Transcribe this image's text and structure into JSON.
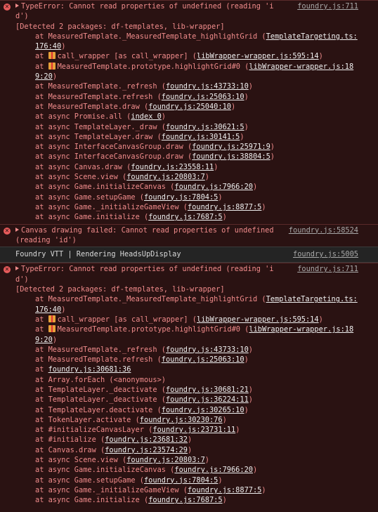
{
  "entries": [
    {
      "kind": "error",
      "source": "foundry.js:711",
      "message": "TypeError: Cannot read properties of undefined (reading 'id')",
      "detected": "[Detected 2 packages: df-templates, lib-wrapper]",
      "frames": [
        {
          "pre": "at MeasuredTemplate._MeasuredTemplate_highlightGrid (",
          "link": "TemplateTargeting.ts:176:40",
          "post": ")"
        },
        {
          "pre": "at ",
          "icon": true,
          "pre2": "call_wrapper [as call_wrapper] (",
          "link": "libWrapper-wrapper.js:595:14",
          "post": ")"
        },
        {
          "pre": "at ",
          "icon": true,
          "pre2": "MeasuredTemplate.prototype.highlightGrid#0 (",
          "link": "libWrapper-wrapper.js:189:20",
          "post": ")"
        },
        {
          "pre": "at MeasuredTemplate._refresh (",
          "link": "foundry.js:43733:10",
          "post": ")"
        },
        {
          "pre": "at MeasuredTemplate.refresh (",
          "link": "foundry.js:25063:10",
          "post": ")"
        },
        {
          "pre": "at MeasuredTemplate.draw (",
          "link": "foundry.js:25040:10",
          "post": ")"
        },
        {
          "pre": "at async Promise.all (",
          "link": "index 0",
          "post": ")"
        },
        {
          "pre": "at async TemplateLayer._draw (",
          "link": "foundry.js:30621:5",
          "post": ")"
        },
        {
          "pre": "at async TemplateLayer.draw (",
          "link": "foundry.js:30141:5",
          "post": ")"
        },
        {
          "pre": "at async InterfaceCanvasGroup.draw (",
          "link": "foundry.js:25971:9",
          "post": ")"
        },
        {
          "pre": "at async InterfaceCanvasGroup.draw (",
          "link": "foundry.js:38804:5",
          "post": ")"
        },
        {
          "pre": "at async Canvas.draw (",
          "link": "foundry.js:23558:11",
          "post": ")"
        },
        {
          "pre": "at async Scene.view (",
          "link": "foundry.js:20803:7",
          "post": ")"
        },
        {
          "pre": "at async Game.initializeCanvas (",
          "link": "foundry.js:7966:20",
          "post": ")"
        },
        {
          "pre": "at async Game.setupGame (",
          "link": "foundry.js:7804:5",
          "post": ")"
        },
        {
          "pre": "at async Game._initializeGameView (",
          "link": "foundry.js:8877:5",
          "post": ")"
        },
        {
          "pre": "at async Game.initialize (",
          "link": "foundry.js:7687:5",
          "post": ")"
        }
      ]
    },
    {
      "kind": "error",
      "source": "foundry.js:58524",
      "message": "Canvas drawing failed: Cannot read properties of undefined (reading 'id')",
      "frames": []
    },
    {
      "kind": "log",
      "source": "foundry.js:5005",
      "message": "Foundry VTT | Rendering HeadsUpDisplay",
      "frames": []
    },
    {
      "kind": "error",
      "source": "foundry.js:711",
      "message": "TypeError: Cannot read properties of undefined (reading 'id')",
      "detected": "[Detected 2 packages: df-templates, lib-wrapper]",
      "frames": [
        {
          "pre": "at MeasuredTemplate._MeasuredTemplate_highlightGrid (",
          "link": "TemplateTargeting.ts:176:40",
          "post": ")"
        },
        {
          "pre": "at ",
          "icon": true,
          "pre2": "call_wrapper [as call_wrapper] (",
          "link": "libWrapper-wrapper.js:595:14",
          "post": ")"
        },
        {
          "pre": "at ",
          "icon": true,
          "pre2": "MeasuredTemplate.prototype.highlightGrid#0 (",
          "link": "libWrapper-wrapper.js:189:20",
          "post": ")"
        },
        {
          "pre": "at MeasuredTemplate._refresh (",
          "link": "foundry.js:43733:10",
          "post": ")"
        },
        {
          "pre": "at MeasuredTemplate.refresh (",
          "link": "foundry.js:25063:10",
          "post": ")"
        },
        {
          "pre": "at ",
          "link": "foundry.js:30681:36",
          "post": ""
        },
        {
          "pre": "at Array.forEach (<anonymous>)",
          "link": "",
          "post": ""
        },
        {
          "pre": "at TemplateLayer._deactivate (",
          "link": "foundry.js:30681:21",
          "post": ")"
        },
        {
          "pre": "at TemplateLayer._deactivate (",
          "link": "foundry.js:36224:11",
          "post": ")"
        },
        {
          "pre": "at TemplateLayer.deactivate (",
          "link": "foundry.js:30265:10",
          "post": ")"
        },
        {
          "pre": "at TokenLayer.activate (",
          "link": "foundry.js:30230:76",
          "post": ")"
        },
        {
          "pre": "at #initializeCanvasLayer (",
          "link": "foundry.js:23731:11",
          "post": ")"
        },
        {
          "pre": "at #initialize (",
          "link": "foundry.js:23681:32",
          "post": ")"
        },
        {
          "pre": "at Canvas.draw (",
          "link": "foundry.js:23574:29",
          "post": ")"
        },
        {
          "pre": "at async Scene.view (",
          "link": "foundry.js:20803:7",
          "post": ")"
        },
        {
          "pre": "at async Game.initializeCanvas (",
          "link": "foundry.js:7966:20",
          "post": ")"
        },
        {
          "pre": "at async Game.setupGame (",
          "link": "foundry.js:7804:5",
          "post": ")"
        },
        {
          "pre": "at async Game._initializeGameView (",
          "link": "foundry.js:8877:5",
          "post": ")"
        },
        {
          "pre": "at async Game.initialize (",
          "link": "foundry.js:7687:5",
          "post": ")"
        }
      ]
    }
  ]
}
